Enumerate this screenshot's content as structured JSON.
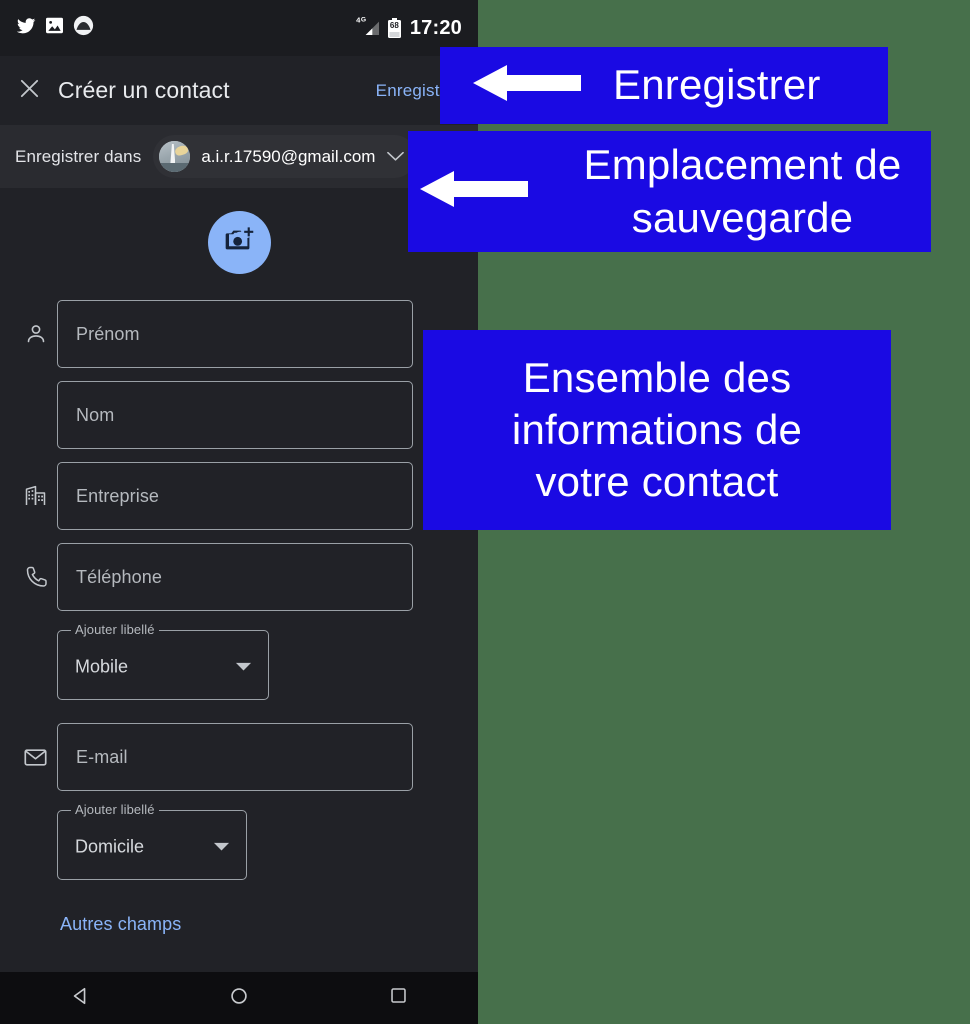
{
  "statusbar": {
    "app_icons": [
      "twitter-icon",
      "gallery-icon",
      "app-circle-icon"
    ],
    "network": "4G",
    "battery_percent": "68",
    "time": "17:20"
  },
  "appbar": {
    "close_icon": "close-icon",
    "title": "Créer un contact",
    "save_label": "Enregistrer"
  },
  "account": {
    "label": "Enregistrer dans",
    "email": "a.i.r.17590@gmail.com",
    "avatar": "account-avatar",
    "caret": "chevron-down-icon"
  },
  "photo": {
    "button_icon": "add-a-photo-icon"
  },
  "fields": [
    {
      "icon": "person-icon",
      "placeholder": "Prénom"
    },
    {
      "icon": "",
      "placeholder": "Nom"
    },
    {
      "icon": "business-icon",
      "placeholder": "Entreprise"
    },
    {
      "icon": "phone-icon",
      "placeholder": "Téléphone"
    },
    {
      "icon": "email-icon",
      "placeholder": "E-mail"
    }
  ],
  "labels": {
    "phone_label_title": "Ajouter libellé",
    "phone_label_value": "Mobile",
    "email_label_title": "Ajouter libellé",
    "email_label_value": "Domicile"
  },
  "more_fields": "Autres champs",
  "navbar": {
    "back": "back-triangle-icon",
    "home": "home-circle-icon",
    "recents": "recents-square-icon"
  },
  "annotations": [
    {
      "text": "Enregistrer",
      "arrow": "left-arrow-icon"
    },
    {
      "text": "Emplacement de\nsauvegarde",
      "arrow": "left-arrow-icon"
    },
    {
      "text": "Ensemble des\ninformations de\nvotre contact",
      "arrow": ""
    }
  ],
  "colors": {
    "page_background": "#47704b",
    "screen_background": "#212227",
    "accent_blue": "#8ab4f8",
    "annotation_blue": "#1a0ae3",
    "field_border": "#9aa0a6"
  }
}
